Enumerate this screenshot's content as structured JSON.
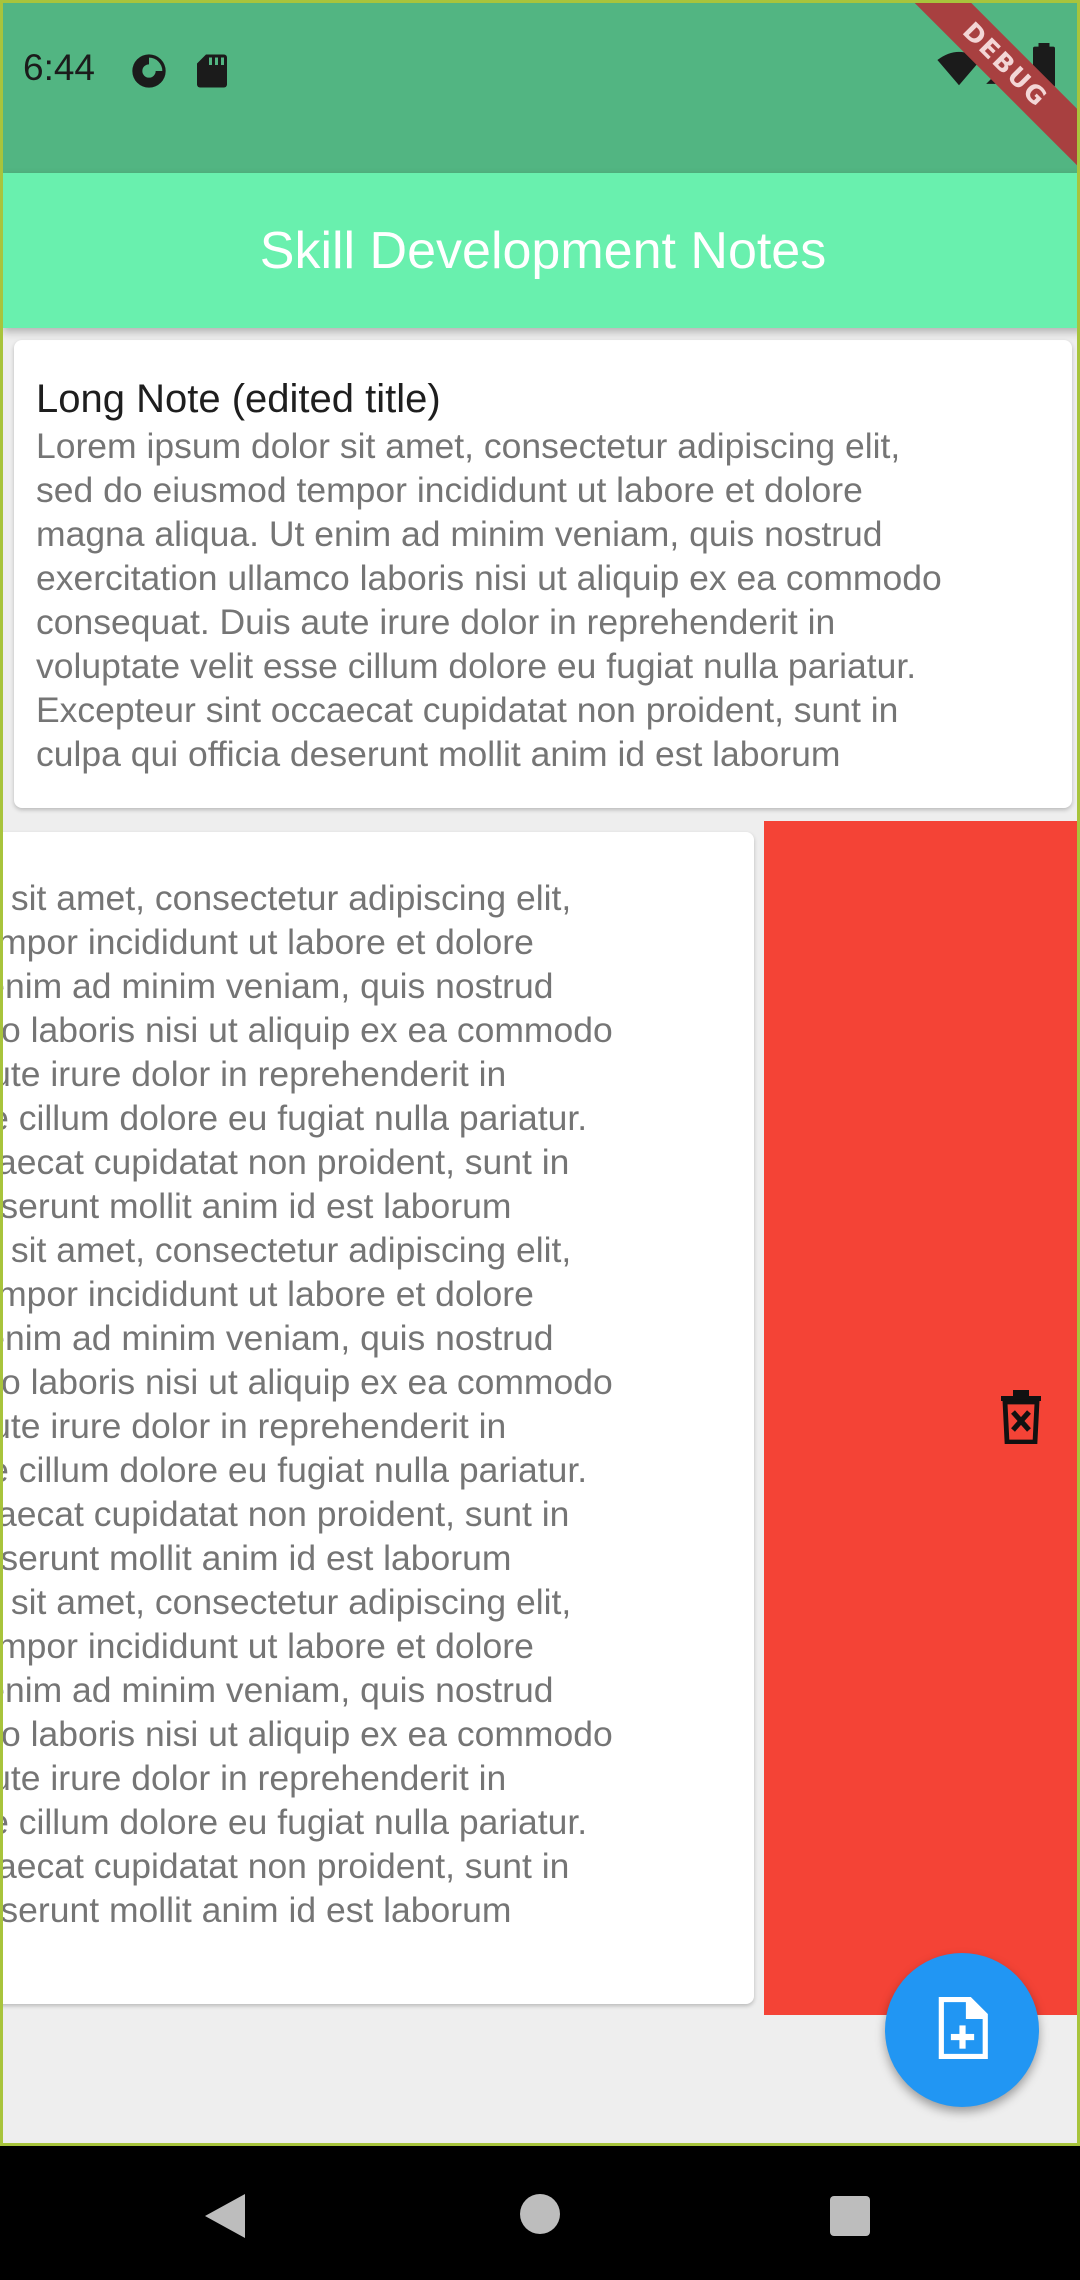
{
  "status_bar": {
    "time": "6:44",
    "icons": [
      "data-saver-icon",
      "sd-card-icon",
      "wifi-icon",
      "signal-icon",
      "battery-icon"
    ],
    "debug_label": "DEBUG"
  },
  "app_bar": {
    "title": "Skill Development Notes",
    "color": "#69f0ae"
  },
  "notes": [
    {
      "title": "Long Note (edited title)",
      "body": "Lorem ipsum dolor sit amet, consectetur adipiscing elit,\nsed do eiusmod tempor incididunt ut labore et dolore\nmagna aliqua. Ut enim ad minim veniam, quis nostrud\nexercitation ullamco laboris nisi ut aliquip ex ea commodo\nconsequat. Duis aute irure dolor in reprehenderit in\nvoluptate velit esse cillum dolore eu fugiat nulla pariatur.\nExcepteur sint occaecat cupidatat non proident, sunt in\nculpa qui officia deserunt mollit anim id est laborum"
    },
    {
      "title": "",
      "body": "Lorem ipsum dolor sit amet, consectetur adipiscing elit,\nsed do eiusmod tempor incididunt ut labore et dolore\nmagna aliqua. Ut enim ad minim veniam, quis nostrud\nexercitation ullamco laboris nisi ut aliquip ex ea commodo\nconsequat. Duis aute irure dolor in reprehenderit in\nvoluptate velit esse cillum dolore eu fugiat nulla pariatur.\nExcepteur sint occaecat cupidatat non proident, sunt in\nculpa qui officia deserunt mollit anim id est laborum\nLorem ipsum dolor sit amet, consectetur adipiscing elit,\nsed do eiusmod tempor incididunt ut labore et dolore\nmagna aliqua. Ut enim ad minim veniam, quis nostrud\nexercitation ullamco laboris nisi ut aliquip ex ea commodo\nconsequat. Duis aute irure dolor in reprehenderit in\nvoluptate velit esse cillum dolore eu fugiat nulla pariatur.\nExcepteur sint occaecat cupidatat non proident, sunt in\nculpa qui officia deserunt mollit anim id est laborum\nLorem ipsum dolor sit amet, consectetur adipiscing elit,\nsed do eiusmod tempor incididunt ut labore et dolore\nmagna aliqua. Ut enim ad minim veniam, quis nostrud\nexercitation ullamco laboris nisi ut aliquip ex ea commodo\nconsequat. Duis aute irure dolor in reprehenderit in\nvoluptate velit esse cillum dolore eu fugiat nulla pariatur.\nExcepteur sint occaecat cupidatat non proident, sunt in\nculpa qui officia deserunt mollit anim id est laborum",
      "swipe_action_icon": "delete-forever-icon",
      "swipe_background": "#f44336"
    }
  ],
  "fab": {
    "icon": "note-add-icon",
    "color": "#2196f3"
  },
  "nav_bar": {
    "buttons": [
      "back-icon",
      "home-icon",
      "recents-icon"
    ]
  }
}
